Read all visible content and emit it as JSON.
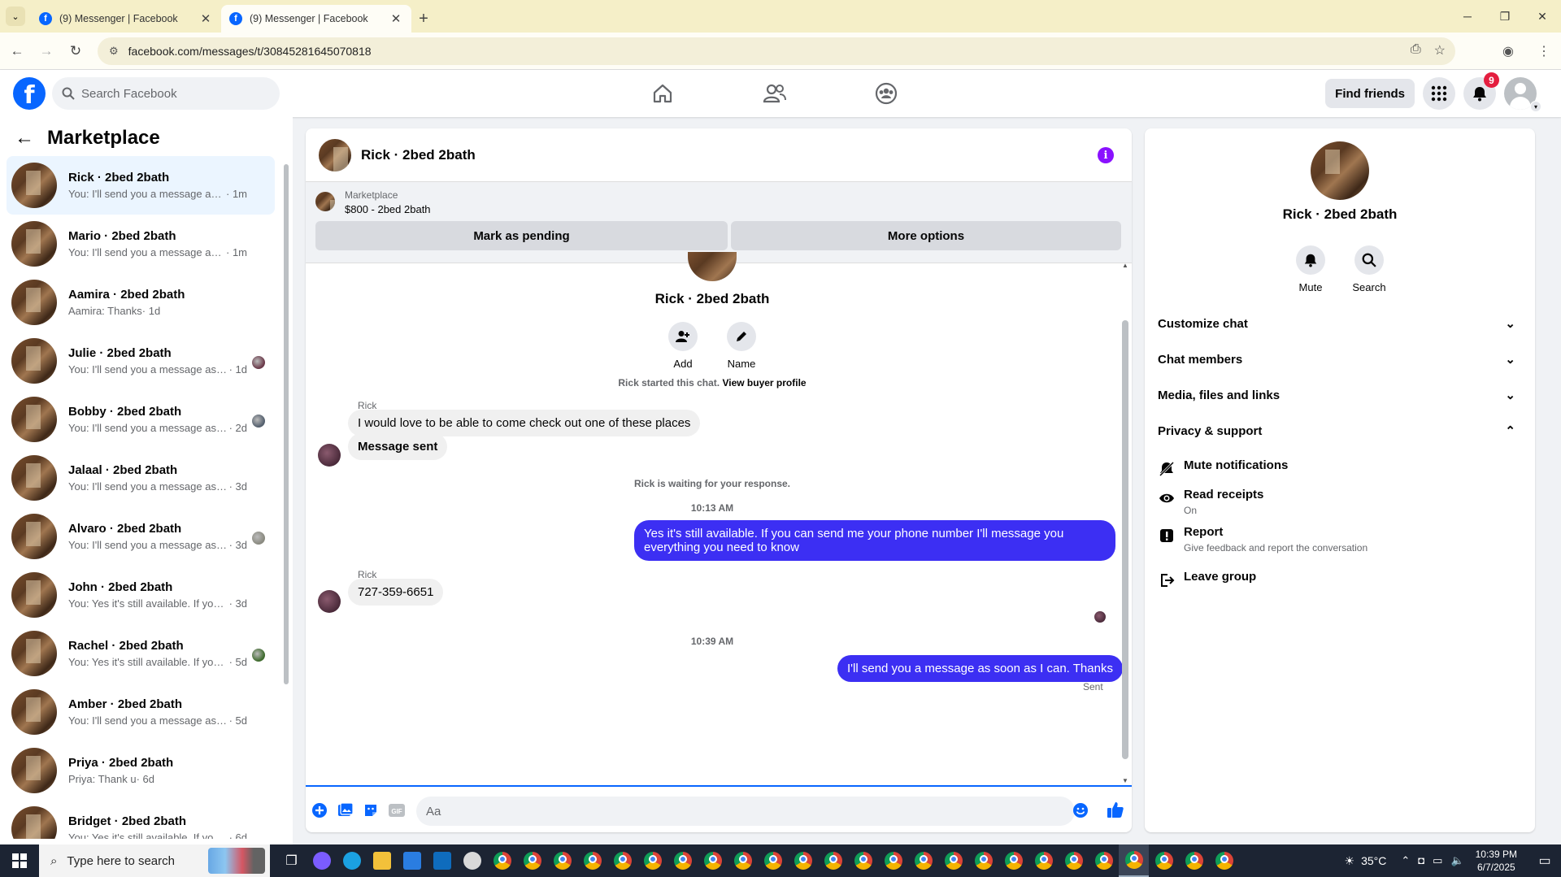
{
  "browser": {
    "tabs": [
      {
        "title": "(9) Messenger | Facebook",
        "active": false
      },
      {
        "title": "(9) Messenger | Facebook",
        "active": true
      }
    ],
    "url": "facebook.com/messages/t/30845281645070818"
  },
  "fb_header": {
    "search_placeholder": "Search Facebook",
    "find_friends": "Find friends",
    "notifications_badge": "9"
  },
  "sidebar": {
    "title": "Marketplace",
    "conversations": [
      {
        "name": "Rick · 2bed 2bath",
        "preview": "You: I'll send you a message as so...",
        "time": " · 1m",
        "active": true,
        "read_avatar": false
      },
      {
        "name": "Mario · 2bed 2bath",
        "preview": "You: I'll send you a message as so...",
        "time": " · 1m",
        "active": false,
        "read_avatar": false
      },
      {
        "name": "Aamira · 2bed 2bath",
        "preview": "Aamira: Thanks",
        "time": " · 1d",
        "active": false,
        "read_avatar": false
      },
      {
        "name": "Julie · 2bed 2bath",
        "preview": "You: I'll send you a message as s...",
        "time": " · 1d",
        "active": false,
        "read_avatar": true,
        "read_color": "#6b3a4a"
      },
      {
        "name": "Bobby · 2bed 2bath",
        "preview": "You: I'll send you a message as s...",
        "time": " · 2d",
        "active": false,
        "read_avatar": true,
        "read_color": "#55606e"
      },
      {
        "name": "Jalaal · 2bed 2bath",
        "preview": "You: I'll send you a message as soo...",
        "time": " · 3d",
        "active": false,
        "read_avatar": false
      },
      {
        "name": "Alvaro · 2bed 2bath",
        "preview": "You: I'll send you a message as s...",
        "time": " · 3d",
        "active": false,
        "read_avatar": true,
        "read_color": "#8a8a80"
      },
      {
        "name": "John · 2bed 2bath",
        "preview": "You: Yes it's still available. If you ca...",
        "time": " · 3d",
        "active": false,
        "read_avatar": false
      },
      {
        "name": "Rachel · 2bed 2bath",
        "preview": "You: Yes it's still available. If you ...",
        "time": " · 5d",
        "active": false,
        "read_avatar": true,
        "read_color": "#3f6b2e"
      },
      {
        "name": "Amber · 2bed 2bath",
        "preview": "You: I'll send you a message as soo...",
        "time": " · 5d",
        "active": false,
        "read_avatar": false
      },
      {
        "name": "Priya · 2bed 2bath",
        "preview": "Priya: Thank u",
        "time": " · 6d",
        "active": false,
        "read_avatar": false
      },
      {
        "name": "Bridget · 2bed 2bath",
        "preview": "You: Yes it's still available. If you ca...",
        "time": " · 6d",
        "active": false,
        "read_avatar": false
      }
    ]
  },
  "chat": {
    "title": "Rick · 2bed 2bath",
    "marketplace_label": "Marketplace",
    "listing": "$800 - 2bed 2bath",
    "mark_pending": "Mark as pending",
    "more_options": "More options",
    "header_name": "Rick · 2bed 2bath",
    "add_label": "Add",
    "name_label": "Name",
    "started_text": "Rick started this chat.",
    "view_profile": "View buyer profile",
    "sender1": "Rick",
    "msg1": "I would love to be able to come check out one of these places",
    "msg2": "Message sent",
    "waiting": "Rick is waiting for your response.",
    "time1": "10:13 AM",
    "my_msg1": "Yes it's still available. If you can send me your phone number I'll message you everything you need to know",
    "sender2": "Rick",
    "msg3": "727-359-6651",
    "time2": "10:39 AM",
    "my_msg2": "I'll send you a message as soon as I can. Thanks",
    "sent_status": "Sent",
    "input_placeholder": "Aa"
  },
  "right_panel": {
    "name": "Rick · 2bed 2bath",
    "mute": "Mute",
    "search": "Search",
    "sections": [
      {
        "label": "Customize chat",
        "expanded": false
      },
      {
        "label": "Chat members",
        "expanded": false
      },
      {
        "label": "Media, files and links",
        "expanded": false
      },
      {
        "label": "Privacy & support",
        "expanded": true
      }
    ],
    "mute_notifications": "Mute notifications",
    "read_receipts": "Read receipts",
    "read_receipts_value": "On",
    "report": "Report",
    "report_desc": "Give feedback and report the conversation",
    "leave_group": "Leave group"
  },
  "taskbar": {
    "search_placeholder": "Type here to search",
    "temperature": "35°C",
    "time": "10:39 PM",
    "date": "6/7/2025"
  },
  "colors": {
    "fb_blue": "#0866ff",
    "my_bubble": "#3c2ff3",
    "info_purple": "#8a11ff",
    "notif_red": "#e41e3f"
  }
}
